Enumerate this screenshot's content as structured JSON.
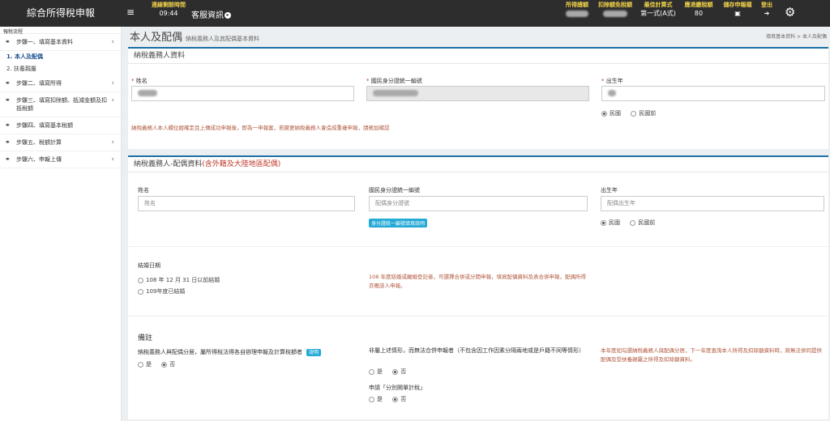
{
  "app": {
    "title": "綜合所得稅申報",
    "menu_icon": "≡"
  },
  "header": {
    "session": {
      "label": "連線剩餘時間",
      "value": "09:44"
    },
    "customer_service": {
      "label": "客服資訊",
      "icon": "▸"
    },
    "stats": [
      {
        "label": "所得總額",
        "value_blurred": true
      },
      {
        "label": "扣除額免稅額",
        "value_blurred": true
      },
      {
        "label": "最佳計算式",
        "value": "第一式(A式)"
      },
      {
        "label": "應退繳稅額",
        "value": "80"
      }
    ],
    "save": {
      "label": "儲存申報檔",
      "icon": "save-icon"
    },
    "logout": {
      "label": "登出",
      "icon": "logout-icon"
    },
    "settings_icon": "gear-icon"
  },
  "sidebar": {
    "title": "報稅流程",
    "steps": [
      {
        "label": "步驟一、填寫基本資料",
        "sub": [
          {
            "label": "1. 本人及配偶",
            "active": true
          },
          {
            "label": "2. 扶養親屬",
            "active": false
          }
        ]
      },
      {
        "label": "步驟二、填寫所得"
      },
      {
        "label": "步驟三、填寫扣除額、抵減金額及扣抵稅額"
      },
      {
        "label": "步驟四、填寫基本稅額"
      },
      {
        "label": "步驟五、稅額計算"
      },
      {
        "label": "步驟六、申報上傳"
      }
    ]
  },
  "page": {
    "title": "本人及配偶",
    "subtitle": "納稅義務人及其配偶基本資料",
    "breadcrumb": [
      "填寫基本資料",
      "本人及配偶"
    ]
  },
  "taxpayer": {
    "heading": "納稅義務人資料",
    "name_label": "姓名",
    "id_label": "國民身分證統一編號",
    "birth_label": "出生年",
    "era_options": [
      "民國",
      "民國前"
    ],
    "era_selected": 0,
    "note": "納稅義務人本人欄位經確定且上傳成功申報後，即為一申報案，若變更納稅義務人會造成重複申報，請務加確認"
  },
  "spouse": {
    "heading": "納稅義務人-配偶資料",
    "heading_note": "(含外籍及大陸地區配偶)",
    "name_label": "姓名",
    "name_placeholder": "姓名",
    "id_label": "國民身分證統一編號",
    "id_placeholder": "配偶身分證號",
    "id_help_button": "身分證統一編號填寫說明",
    "birth_label": "出生年",
    "birth_placeholder": "配偶出生年",
    "era_options": [
      "民國",
      "民國前"
    ],
    "era_selected": 0,
    "marriage_label": "結婚日期",
    "marriage_options": [
      "108 年 12 月 31 日以前結婚",
      "109年度已結婚"
    ],
    "marriage_note": "108 年度結婚或離婚登記者，可選擇合併或分開申報，填寫配偶資料及表合併申報，配偶所得亦應該人申報。",
    "remarks_label": "備註",
    "q1": "納稅義務人與配偶分居，屬所得稅法得各自辦理申報及計算稅額者",
    "q1_help": "說明",
    "q2": "非屬上述情形，而無法合併申報者（不包含因工作因素分隔兩地或是戶籍不同等情形）",
    "q3": "申請「分別開單計稅」",
    "yes": "是",
    "no": "否",
    "q_note": "本年度如勾選納稅義務人與配偶分居，下一年度查詢本人所得及扣除額資料時，將無法併同提供配偶及受扶養親屬之所得及扣除額資料。"
  }
}
